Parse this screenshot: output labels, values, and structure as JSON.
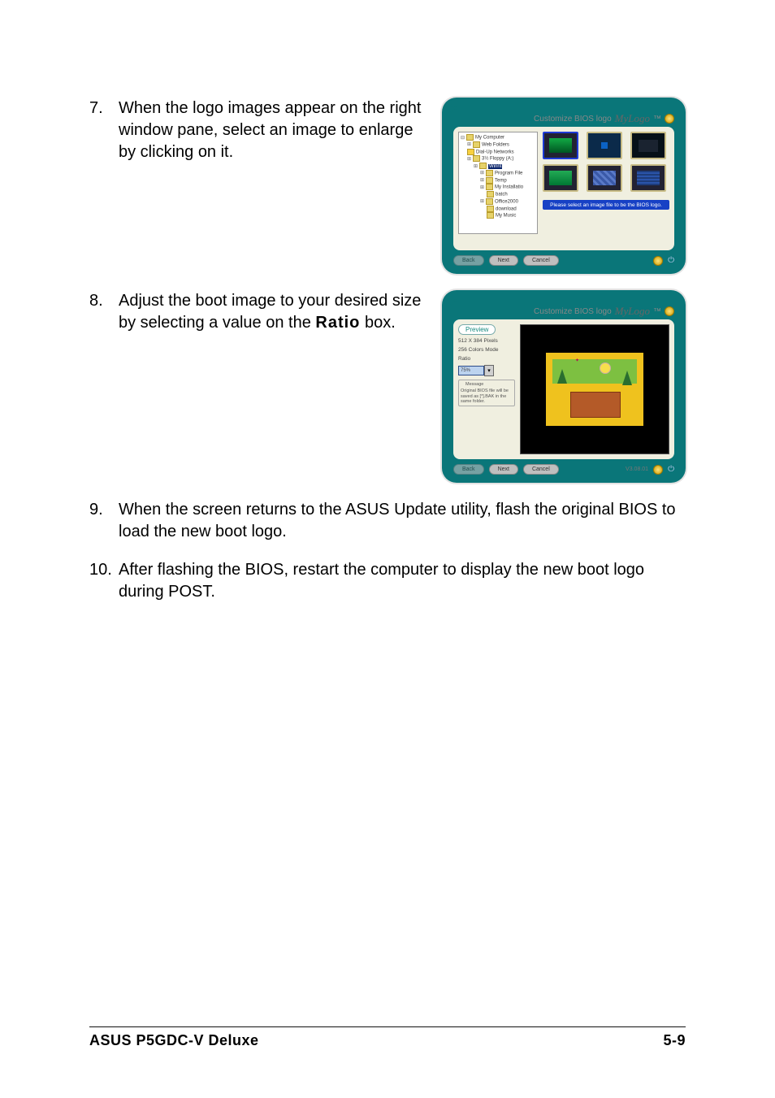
{
  "steps": {
    "s7": {
      "num": "7.",
      "text_a": "When the logo images appear on the right window pane, select an image to enlarge by clicking on it."
    },
    "s8": {
      "num": "8.",
      "text_a": "Adjust the boot image to your desired size by selecting a value on the ",
      "bold": "Ratio",
      "text_b": " box."
    },
    "s9": {
      "num": "9.",
      "text": "When the screen returns to the ASUS Update utility, flash the original BIOS to load the new boot logo."
    },
    "s10": {
      "num": "10.",
      "text": "After flashing the BIOS, restart the computer to display the new boot logo during POST."
    }
  },
  "fig1": {
    "brand_small": "Customize BIOS logo",
    "brand": "MyLogo",
    "tm": "™",
    "tree": [
      "My Computer",
      "Web Folders",
      "Dial-Up Networks",
      "3½ Floppy (A:)",
      "Winnt",
      "Program File",
      "Temp",
      "My Installatio",
      "batch",
      "Office2000",
      "download",
      "My Music"
    ],
    "tree_selected_index": 4,
    "status": "Please select an image file to be the BIOS logo.",
    "buttons": {
      "back": "Back",
      "next": "Next",
      "cancel": "Cancel"
    }
  },
  "fig2": {
    "brand_small": "Customize BIOS logo",
    "brand": "MyLogo",
    "tm": "™",
    "preview_label": "Preview",
    "spec1": "512 X 384 Pixels",
    "spec2": "256 Colors Mode",
    "ratio_label": "Ratio",
    "ratio_value": "75%",
    "message_title": "Message",
    "message_body": "Original BIOS file will be saved as [*].BAK in the same folder.",
    "buttons": {
      "back": "Back",
      "next": "Next",
      "cancel": "Cancel"
    },
    "version": "V3.08.01"
  },
  "footer": {
    "left": "ASUS P5GDC-V Deluxe",
    "right": "5-9"
  }
}
